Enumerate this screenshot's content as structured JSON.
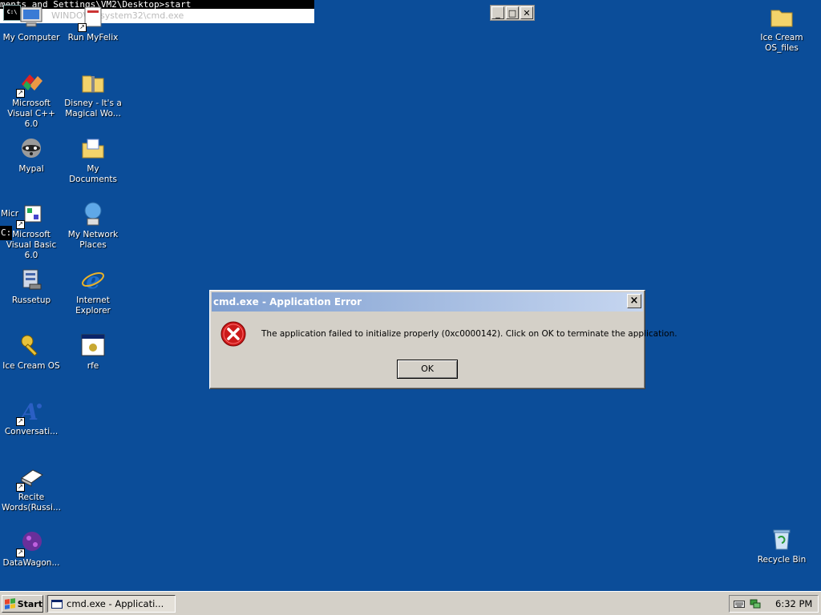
{
  "console": {
    "text_line": "ments and Settings\\VM2\\Desktop>start",
    "title": "WINDOWS\\system32\\cmd.exe",
    "icon_text": "C:\\",
    "prompt_fragment": "C:"
  },
  "desktop_icons": [
    {
      "label": "My Computer",
      "icon": "computer-icon"
    },
    {
      "label": "Run MyFelix",
      "icon": "shortcut-icon"
    },
    {
      "label": "Microsoft Visual C++ 6.0",
      "icon": "visual-cpp-icon"
    },
    {
      "label": "Disney - It's a Magical Wo...",
      "icon": "zip-folder-icon"
    },
    {
      "label": "Mypal",
      "icon": "raccoon-icon"
    },
    {
      "label": "My Documents",
      "icon": "documents-folder-icon"
    },
    {
      "label": "Microsoft Visual Basic 6.0",
      "label_overlap": "Micr",
      "icon": "visual-basic-icon"
    },
    {
      "label": "My Network Places",
      "icon": "network-icon"
    },
    {
      "label": "Russetup",
      "icon": "setup-icon"
    },
    {
      "label": "Internet Explorer",
      "icon": "ie-icon"
    },
    {
      "label": "Ice Cream OS",
      "icon": "key-icon"
    },
    {
      "label": "rfe",
      "icon": "app-window-icon"
    },
    {
      "label": "Conversati...",
      "icon": "agent-icon"
    },
    {
      "label": "Recite Words(Russi...",
      "icon": "book-icon"
    },
    {
      "label": "DataWagon...",
      "icon": "datawagon-icon"
    },
    {
      "label": "Ice Cream OS_files",
      "icon": "folder-icon"
    },
    {
      "label": "Recycle Bin",
      "icon": "recycle-bin-icon"
    }
  ],
  "dialog": {
    "title": "cmd.exe - Application Error",
    "close": "×",
    "message": "The application failed to initialize properly (0xc0000142). Click on OK to terminate the application.",
    "ok_label": "OK"
  },
  "taskbar": {
    "start_label": "Start",
    "task_label": "cmd.exe - Applicati...",
    "clock": "6:32 PM"
  },
  "colors": {
    "desktop": "#0b4d99",
    "titlebar_start": "#7f9fd0",
    "titlebar_end": "#c6d6f0",
    "error_red": "#cc1a1a"
  }
}
